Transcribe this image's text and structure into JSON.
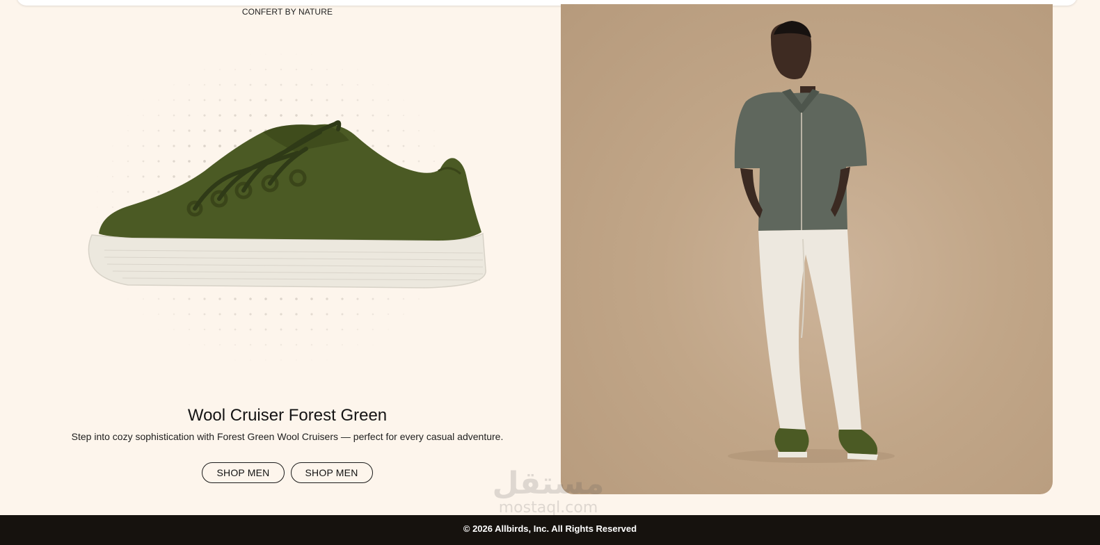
{
  "header": {
    "tagline": "CONFERT BY NATURE"
  },
  "product": {
    "title": "Wool Cruiser Forest Green",
    "description": "Step into cozy sophistication with Forest Green Wool Cruisers — perfect for every casual adventure.",
    "image_icon": "sneaker-image"
  },
  "actions": {
    "primary_label": "SHOP MEN",
    "secondary_label": "SHOP MEN"
  },
  "hero": {
    "image_icon": "model-photo"
  },
  "watermark": {
    "logo": "مستقل",
    "url": "mostaql.com"
  },
  "footer": {
    "copyright": "© 2026 Allbirds, Inc. All Rights Reserved"
  },
  "colors": {
    "page_bg": "#fdf5ec",
    "shoe_green": "#4b5a24",
    "sole": "#ece8de",
    "photo_bg": "#c1a688",
    "footer_bg": "#16120e"
  }
}
